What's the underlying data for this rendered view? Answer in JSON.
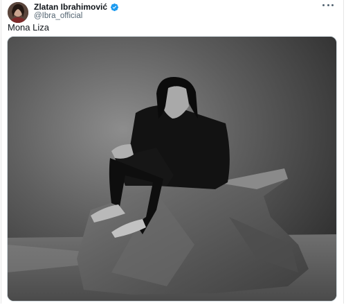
{
  "tweet": {
    "author": {
      "display_name": "Zlatan Ibrahimović",
      "handle": "@Ibra_official",
      "verified": true,
      "verified_color": "#1d9bf0",
      "avatar_icon": "profile-photo"
    },
    "text": "Mona Liza",
    "more_icon": "more-horizontal-icon",
    "media": {
      "kind": "photo",
      "style": "black-and-white studio portrait"
    }
  },
  "colors": {
    "text_primary": "#0f1419",
    "text_secondary": "#536471",
    "border": "#cfd9de"
  }
}
